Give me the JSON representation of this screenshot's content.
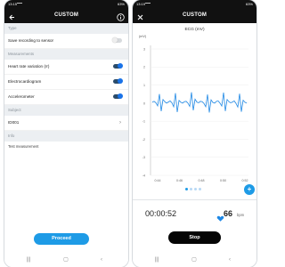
{
  "colors": {
    "accent": "#1e9be6",
    "appbar": "#111111",
    "toggle_on": "#1a73e8",
    "ecg_line": "#1e88e5"
  },
  "left_screen": {
    "status": {
      "time": "13:15",
      "battery": "63%"
    },
    "appbar": {
      "title": "CUSTOM",
      "back_icon": "arrow-left-icon",
      "info_icon": "info-icon"
    },
    "sections": {
      "type": "Type",
      "measurements": "Measurements",
      "subject": "Subject",
      "info": "Info"
    },
    "rows": {
      "save_recording": {
        "label": "Save recording to sensor",
        "on": false
      },
      "hrv": {
        "label": "Heart rate variation (rr)",
        "on": true
      },
      "ecg": {
        "label": "Electrocardiogram",
        "on": true
      },
      "acc": {
        "label": "Accelerometer",
        "on": true
      }
    },
    "subject_id": "ID001",
    "info_text": "Test measurement",
    "proceed_label": "Proceed"
  },
  "right_screen": {
    "status": {
      "time": "13:19",
      "battery": "63%"
    },
    "appbar": {
      "title": "CUSTOM",
      "close_icon": "close-icon"
    },
    "chart_title": "ECG (mV)",
    "chart_unit": "(mV)",
    "chart_data": {
      "type": "line",
      "title": "ECG (mV)",
      "ylabel": "(mV)",
      "ylim": [
        -4,
        3
      ],
      "y_ticks": [
        "3",
        "2",
        "1",
        "0",
        "-1",
        "-2",
        "-3",
        "-4"
      ],
      "x_ticks": [
        "0:44",
        "0:46",
        "0:48",
        "0:50",
        "0:52"
      ],
      "series": [
        {
          "values": [
            0.05,
            0.1,
            0.02,
            -0.15,
            0.5,
            -0.45,
            0.2,
            0.08,
            0.0,
            0.06,
            0.12,
            0.02,
            -0.2,
            0.55,
            -0.5,
            0.15,
            0.05,
            0.0,
            0.08,
            0.1,
            0.0,
            -0.18,
            0.6,
            -0.4,
            0.22,
            0.06,
            0.02,
            0.1,
            0.08,
            -0.02,
            -0.2,
            0.48,
            -0.52,
            0.18,
            0.04,
            0.0,
            0.1,
            0.12,
            0.0,
            -0.16,
            0.58,
            -0.44,
            0.2,
            0.08,
            0.02,
            0.06,
            0.12,
            -0.02,
            -0.22,
            0.52,
            -0.48,
            0.16,
            0.05,
            0.0
          ]
        }
      ]
    },
    "pager": {
      "pages": 4,
      "active": 0
    },
    "fab_icon": "plus-icon",
    "timer": "00:00:52",
    "heart_icon": "heart-icon",
    "hr_value": "66",
    "hr_unit": "bpm",
    "stop_label": "Stop"
  },
  "nav_icons": [
    "recents-icon",
    "home-icon",
    "back-icon"
  ]
}
